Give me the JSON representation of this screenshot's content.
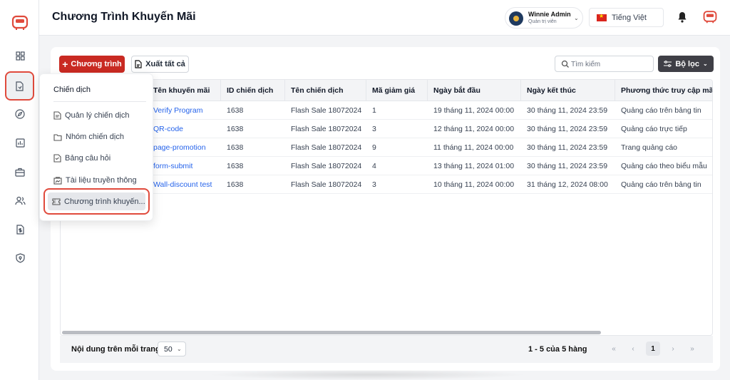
{
  "header": {
    "title": "Chương Trình Khuyến Mãi",
    "user_name": "Winnie Admin",
    "user_role": "Quản trị viên",
    "language": "Tiếng Việt"
  },
  "sidebar": {
    "icons": [
      "dashboard-icon",
      "campaign-icon",
      "compass-icon",
      "report-icon",
      "briefcase-icon",
      "users-icon",
      "billing-icon",
      "security-icon"
    ]
  },
  "toolbar": {
    "add_label": "Chương trình",
    "export_label": "Xuất tất cả",
    "search_placeholder": "Tìm kiếm",
    "filter_label": "Bộ lọc"
  },
  "table": {
    "columns": [
      "Tên khuyến mãi",
      "ID chiến dịch",
      "Tên chiến dịch",
      "Mã giảm giá",
      "Ngày bắt đầu",
      "Ngày kết thúc",
      "Phương thức truy cập mã"
    ],
    "rows": [
      [
        "Verify Program",
        "1638",
        "Flash Sale 18072024",
        "1",
        "19 tháng 11, 2024 00:00",
        "30 tháng 11, 2024 23:59",
        "Quảng cáo trên bảng tin"
      ],
      [
        "QR-code",
        "1638",
        "Flash Sale 18072024",
        "3",
        "12 tháng 11, 2024 00:00",
        "30 tháng 11, 2024 23:59",
        "Quảng cáo trực tiếp"
      ],
      [
        "page-promotion",
        "1638",
        "Flash Sale 18072024",
        "9",
        "11 tháng 11, 2024 00:00",
        "30 tháng 11, 2024 23:59",
        "Trang quảng cáo"
      ],
      [
        "form-submit",
        "1638",
        "Flash Sale 18072024",
        "4",
        "13 tháng 11, 2024 01:00",
        "30 tháng 11, 2024 23:59",
        "Quảng cáo theo biểu mẫu"
      ],
      [
        "Wall-discount test",
        "1638",
        "Flash Sale 18072024",
        "3",
        "10 tháng 11, 2024 00:00",
        "31 tháng 12, 2024 08:00",
        "Quảng cáo trên bảng tin"
      ]
    ]
  },
  "footer": {
    "per_page_label": "Nội dung trên mỗi trang:",
    "per_page_value": "50",
    "range_text": "1 - 5 của 5 hàng",
    "first": "«",
    "prev": "‹",
    "current_page": "1",
    "next": "›",
    "last": "»"
  },
  "dropdown": {
    "title": "Chiến dịch",
    "items": [
      "Quản lý chiến dịch",
      "Nhóm chiến dịch",
      "Bảng câu hỏi",
      "Tài liệu truyền thông",
      "Chương trình khuyến..."
    ]
  },
  "colors": {
    "brand": "#c92a22",
    "link": "#2563eb",
    "highlight": "#e04a3c"
  }
}
